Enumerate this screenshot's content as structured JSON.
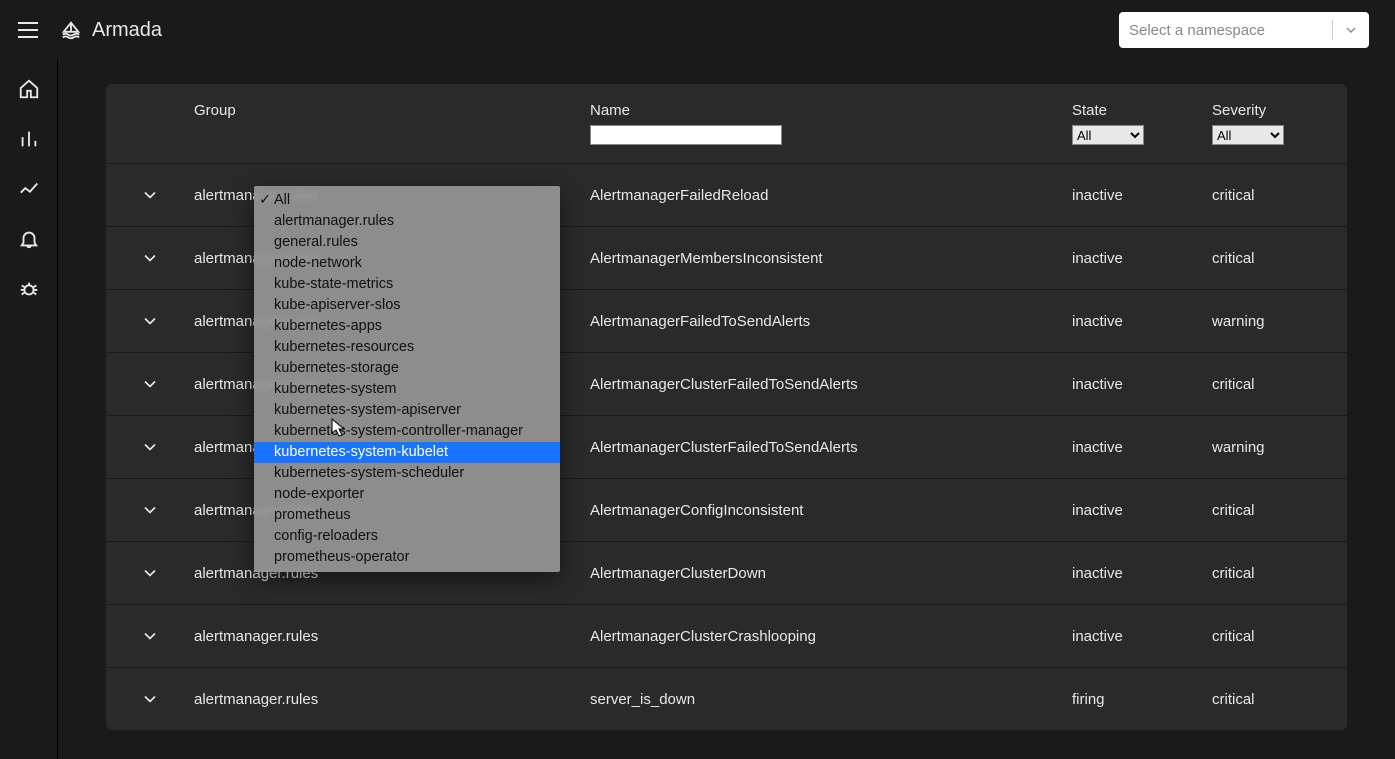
{
  "app": {
    "title": "Armada"
  },
  "namespace_select": {
    "placeholder": "Select a namespace"
  },
  "filters": {
    "group_label": "Group",
    "name_label": "Name",
    "name_value": "",
    "state_label": "State",
    "state_value": "All",
    "severity_label": "Severity",
    "severity_value": "All"
  },
  "group_dropdown": {
    "options": [
      "All",
      "alertmanager.rules",
      "general.rules",
      "node-network",
      "kube-state-metrics",
      "kube-apiserver-slos",
      "kubernetes-apps",
      "kubernetes-resources",
      "kubernetes-storage",
      "kubernetes-system",
      "kubernetes-system-apiserver",
      "kubernetes-system-controller-manager",
      "kubernetes-system-kubelet",
      "kubernetes-system-scheduler",
      "node-exporter",
      "prometheus",
      "config-reloaders",
      "prometheus-operator"
    ],
    "checked_index": 0,
    "highlight_index": 12
  },
  "alerts": [
    {
      "group": "alertmanager.rules",
      "name": "AlertmanagerFailedReload",
      "state": "inactive",
      "severity": "critical"
    },
    {
      "group": "alertmanager.rules",
      "name": "AlertmanagerMembersInconsistent",
      "state": "inactive",
      "severity": "critical"
    },
    {
      "group": "alertmanager.rules",
      "name": "AlertmanagerFailedToSendAlerts",
      "state": "inactive",
      "severity": "warning"
    },
    {
      "group": "alertmanager.rules",
      "name": "AlertmanagerClusterFailedToSendAlerts",
      "state": "inactive",
      "severity": "critical"
    },
    {
      "group": "alertmanager.rules",
      "name": "AlertmanagerClusterFailedToSendAlerts",
      "state": "inactive",
      "severity": "warning"
    },
    {
      "group": "alertmanager.rules",
      "name": "AlertmanagerConfigInconsistent",
      "state": "inactive",
      "severity": "critical"
    },
    {
      "group": "alertmanager.rules",
      "name": "AlertmanagerClusterDown",
      "state": "inactive",
      "severity": "critical"
    },
    {
      "group": "alertmanager.rules",
      "name": "AlertmanagerClusterCrashlooping",
      "state": "inactive",
      "severity": "critical"
    },
    {
      "group": "alertmanager.rules",
      "name": "server_is_down",
      "state": "firing",
      "severity": "critical"
    }
  ]
}
